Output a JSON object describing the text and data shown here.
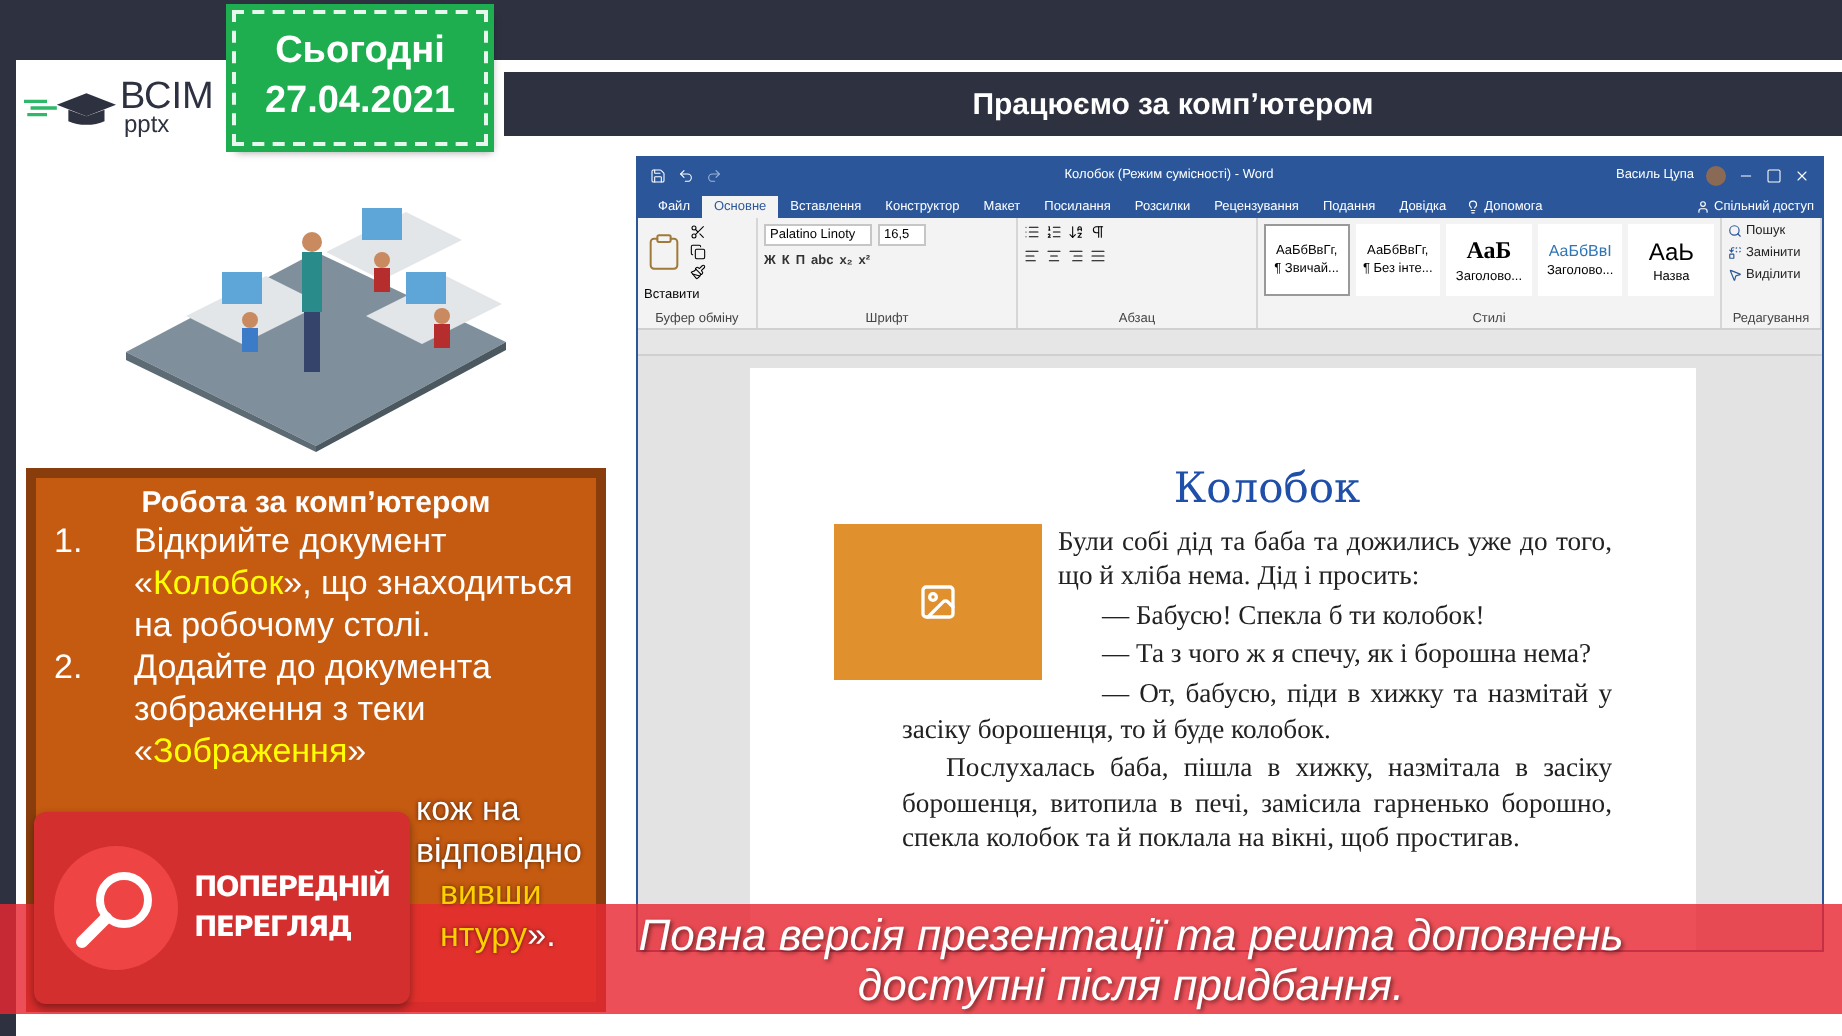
{
  "logo": {
    "main": "ВСІМ",
    "sub": "pptx"
  },
  "date_tag": {
    "label": "Сьогодні",
    "date": "27.04.2021"
  },
  "slide_title": "Працюємо за комп’ютером",
  "task_panel": {
    "title": "Робота за комп’ютером",
    "items": [
      {
        "number": "1.",
        "segments": [
          {
            "text": "Відкрийте документ «",
            "highlight": false
          },
          {
            "text": "Колобок",
            "highlight": true
          },
          {
            "text": "», що знаходиться на робочому столі.",
            "highlight": false
          }
        ]
      },
      {
        "number": "2.",
        "segments": [
          {
            "text": "Додайте до документа зображення з теки «",
            "highlight": false
          },
          {
            "text": "Зображення",
            "highlight": true
          },
          {
            "text": "»",
            "highlight": false
          }
        ]
      }
    ],
    "fragments": [
      [
        {
          "text": "кож на",
          "highlight": false
        }
      ],
      [
        {
          "text": "відповідно",
          "highlight": false
        }
      ],
      [
        {
          "text": "вивши",
          "highlight": true
        }
      ],
      [
        {
          "text": "нтуру",
          "highlight": true
        },
        {
          "text": "».",
          "highlight": false
        }
      ]
    ]
  },
  "word": {
    "title": "Колобок (Режим сумісності) - Word",
    "user": "Василь Цупа",
    "tabs": [
      {
        "label": "Файл",
        "selected": false
      },
      {
        "label": "Основне",
        "selected": true
      },
      {
        "label": "Вставлення",
        "selected": false
      },
      {
        "label": "Конструктор",
        "selected": false
      },
      {
        "label": "Макет",
        "selected": false
      },
      {
        "label": "Посилання",
        "selected": false
      },
      {
        "label": "Розсилки",
        "selected": false
      },
      {
        "label": "Рецензування",
        "selected": false
      },
      {
        "label": "Подання",
        "selected": false
      },
      {
        "label": "Довідка",
        "selected": false
      }
    ],
    "help": "Допомога",
    "share": "Спільний доступ",
    "paste": "Вставити",
    "font_name": "Palatino Linoty",
    "font_size": "16,5",
    "font_buttons": [
      "Ж",
      "К",
      "П",
      "abc",
      "x₂",
      "x²"
    ],
    "styles": [
      {
        "sample": "АаБбВвГг,",
        "name": "¶ Звичай...",
        "kind": "normal",
        "selected": true
      },
      {
        "sample": "АаБбВвГг,",
        "name": "¶ Без інте...",
        "kind": "normal",
        "selected": false
      },
      {
        "sample": "АаБ",
        "name": "Заголово...",
        "kind": "heading1",
        "selected": false
      },
      {
        "sample": "АаБбВвІ",
        "name": "Заголово...",
        "kind": "heading2",
        "selected": false
      },
      {
        "sample": "АаЬ",
        "name": "Назва",
        "kind": "title",
        "selected": false
      }
    ],
    "editing": [
      "Пошук",
      "Замінити",
      "Виділити"
    ],
    "groups": [
      "Буфер обміну",
      "Шрифт",
      "Абзац",
      "Стилі",
      "Редагування"
    ],
    "document": {
      "heading": "Колобок",
      "paragraphs": [
        {
          "text": "Були собі дід та баба та дожились уже до того, що й хліба нема. Дід і просить:",
          "indent": false
        },
        {
          "text": "— Бабусю! Спекла б ти колобок!",
          "indent": true
        },
        {
          "text": "— Та з чого ж я спечу, як і борошна нема?",
          "indent": true
        },
        {
          "text": "— От, бабусю, піди в хижку та назмітай у засіку борошенця, то й буде колобок.",
          "indent": true
        },
        {
          "text": "Послухалась баба, пішла в хижку, назмітала в засіку борошенця, витопила в печі, замісила гарненько борошно, спекла колобок та й поклала на вікні, щоб простигав.",
          "indent": true
        }
      ]
    }
  },
  "preview_badge": "ПОПЕРЕДНІЙ ПЕРЕГЛЯД",
  "banner": [
    "Повна версія презентації та решта доповнень",
    "доступні після придбання."
  ]
}
